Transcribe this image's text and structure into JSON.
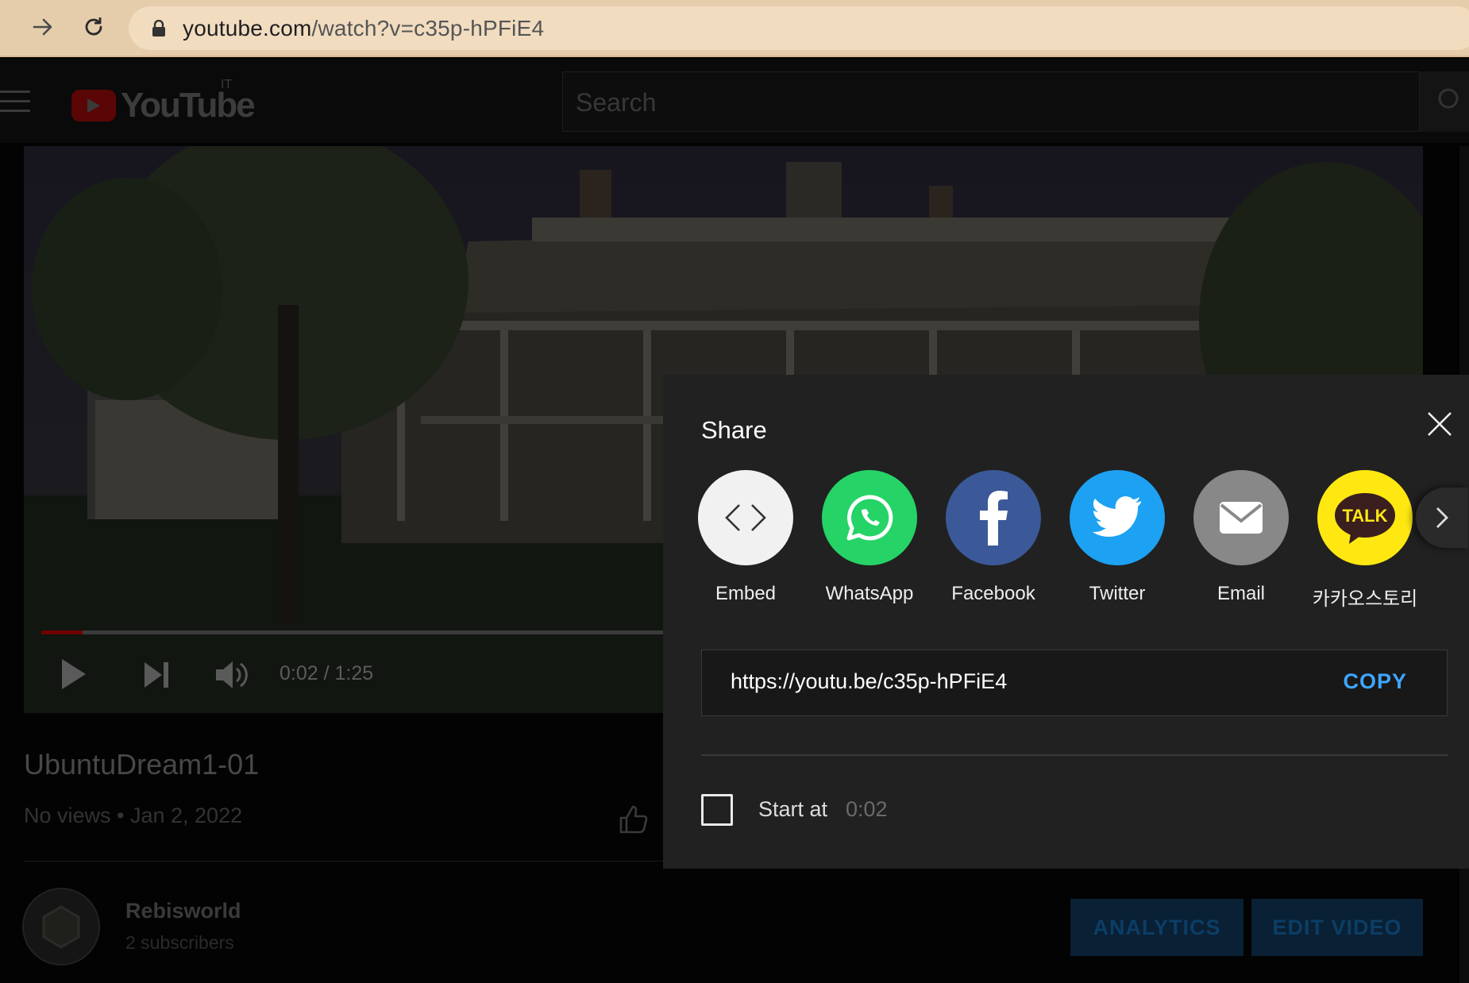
{
  "browser": {
    "url_domain": "youtube.com",
    "url_path": "/watch?v=c35p-hPFiE4"
  },
  "header": {
    "logo_text": "YouTube",
    "region": "IT",
    "search_placeholder": "Search"
  },
  "player": {
    "current_time": "0:02",
    "duration": "1:25",
    "time_display": "0:02 / 1:25",
    "progress_fraction": 0.03
  },
  "video": {
    "title": "UbuntuDream1-01",
    "meta": "No views • Jan 2, 2022"
  },
  "channel": {
    "name": "Rebisworld",
    "subscribers": "2 subscribers",
    "analytics_label": "ANALYTICS",
    "edit_label": "EDIT VIDEO"
  },
  "share": {
    "title": "Share",
    "targets": [
      {
        "label": "Embed",
        "icon": "embed-icon",
        "color": "#f1f1f1"
      },
      {
        "label": "WhatsApp",
        "icon": "whatsapp-icon",
        "color": "#25d366"
      },
      {
        "label": "Facebook",
        "icon": "facebook-icon",
        "color": "#3b5998"
      },
      {
        "label": "Twitter",
        "icon": "twitter-icon",
        "color": "#1da1f2"
      },
      {
        "label": "Email",
        "icon": "email-icon",
        "color": "#888888"
      },
      {
        "label": "카카오스토리",
        "icon": "kakaotalk-icon",
        "color": "#ffe812"
      }
    ],
    "kakao_badge": "TALK",
    "link": "https://youtu.be/c35p-hPFiE4",
    "copy_label": "COPY",
    "start_at_label": "Start at",
    "start_at_time": "0:02",
    "start_at_checked": false
  },
  "colors": {
    "accent": "#3ea6ff",
    "dialog_bg": "#212121"
  }
}
